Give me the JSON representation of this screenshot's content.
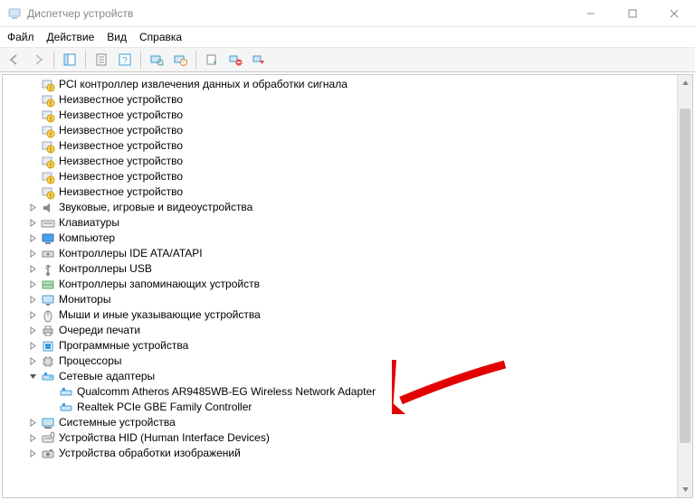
{
  "window": {
    "title": "Диспетчер устройств"
  },
  "menu": {
    "file": "Файл",
    "action": "Действие",
    "view": "Вид",
    "help": "Справка"
  },
  "tree": {
    "pci": "PCI контроллер извлечения данных и обработки сигнала",
    "unknown1": "Неизвестное устройство",
    "unknown2": "Неизвестное устройство",
    "unknown3": "Неизвестное устройство",
    "unknown4": "Неизвестное устройство",
    "unknown5": "Неизвестное устройство",
    "unknown6": "Неизвестное устройство",
    "unknown7": "Неизвестное устройство",
    "sound": "Звуковые, игровые и видеоустройства",
    "keyboards": "Клавиатуры",
    "computer": "Компьютер",
    "ide": "Контроллеры IDE ATA/ATAPI",
    "usb": "Контроллеры USB",
    "storage": "Контроллеры запоминающих устройств",
    "monitors": "Мониторы",
    "mice": "Мыши и иные указывающие устройства",
    "printq": "Очереди печати",
    "softdev": "Программные устройства",
    "cpus": "Процессоры",
    "netadapters": "Сетевые адаптеры",
    "net_qualcomm": "Qualcomm Atheros AR9485WB-EG Wireless Network Adapter",
    "net_realtek": "Realtek PCIe GBE Family Controller",
    "sysdev": "Системные устройства",
    "hid": "Устройства HID (Human Interface Devices)",
    "imaging": "Устройства обработки изображений"
  }
}
